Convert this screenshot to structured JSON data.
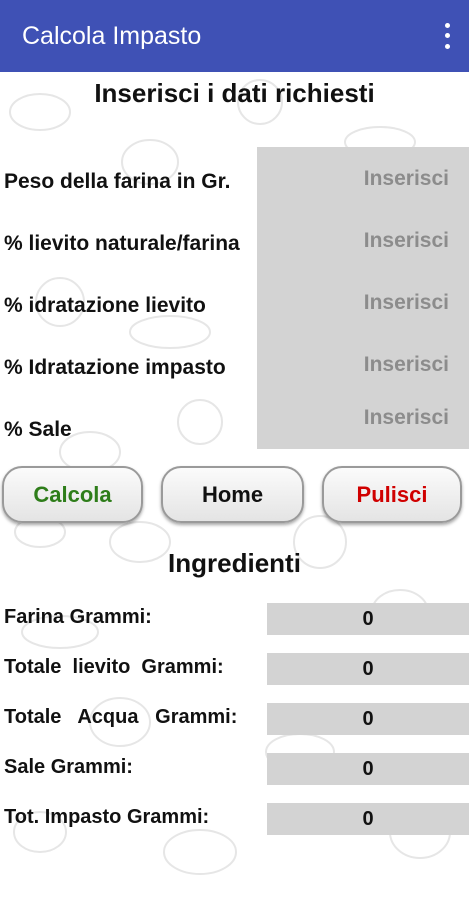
{
  "appbar": {
    "title": "Calcola Impasto",
    "overflow_icon": "more-vert-icon",
    "color": "#3f51b5"
  },
  "form": {
    "heading": "Inserisci i dati richiesti",
    "fields": [
      {
        "label": "Peso della farina in Gr.",
        "placeholder": "Inserisci",
        "value": ""
      },
      {
        "label": "% lievito naturale/farina",
        "placeholder": "Inserisci",
        "value": ""
      },
      {
        "label": "% idratazione lievito",
        "placeholder": "Inserisci",
        "value": ""
      },
      {
        "label": "% Idratazione impasto",
        "placeholder": "Inserisci",
        "value": ""
      },
      {
        "label": "% Sale",
        "placeholder": "Inserisci",
        "value": ""
      }
    ]
  },
  "buttons": {
    "calcola": {
      "label": "Calcola",
      "color": "#2e7d1a"
    },
    "home": {
      "label": "Home",
      "color": "#111111"
    },
    "pulisci": {
      "label": "Pulisci",
      "color": "#d00000"
    }
  },
  "results": {
    "heading": "Ingredienti",
    "rows": [
      {
        "label": "Farina Grammi:",
        "value": "0"
      },
      {
        "label": "Totale  lievito  Grammi:",
        "value": "0"
      },
      {
        "label": "Totale   Acqua   Grammi:",
        "value": "0"
      },
      {
        "label": "Sale Grammi:",
        "value": "0"
      },
      {
        "label": "Tot. Impasto Grammi:",
        "value": "0"
      }
    ]
  }
}
